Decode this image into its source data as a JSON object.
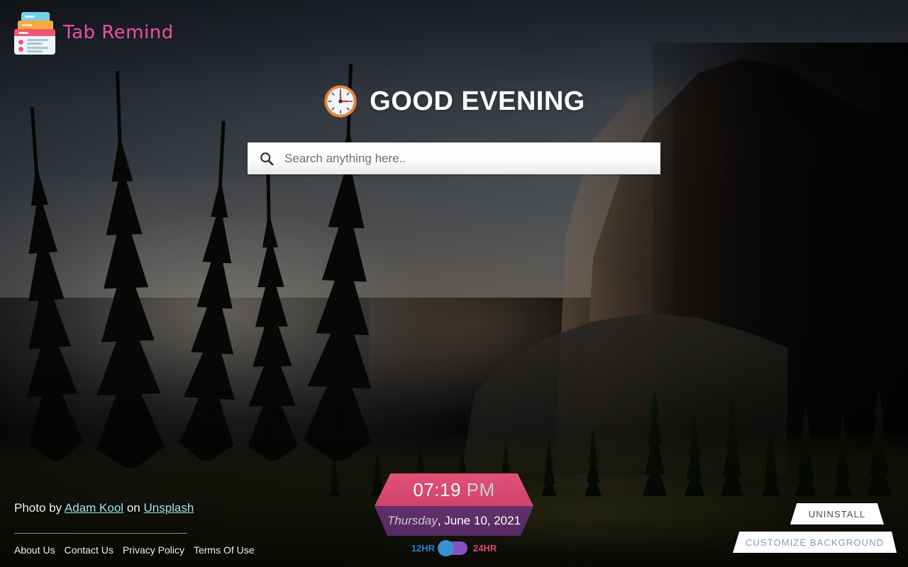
{
  "brand": {
    "name": "Tab Remind",
    "logo_icon": "stacked-tabs-icon",
    "name_color": "#ef4fa0"
  },
  "greeting": {
    "icon": "clock-icon",
    "text": "GOOD EVENING"
  },
  "search": {
    "icon": "search-icon",
    "value": "",
    "placeholder": "Search anything here.."
  },
  "clock_widget": {
    "time": "07:19",
    "meridiem": "PM",
    "day_of_week": "Thursday",
    "date_rest": ", June 10, 2021",
    "time_band_color": "#d9456f",
    "date_band_color": "#6b3a7a",
    "toggle": {
      "left_label": "12HR",
      "right_label": "24HR",
      "left_label_color": "#2f80d6",
      "right_label_color": "#e8467e",
      "track_color": "#8b4fc4",
      "knob_color": "#3b8fd4",
      "state": "12HR"
    }
  },
  "credit": {
    "prefix": "Photo by",
    "author": "Adam Kool",
    "middle": "on",
    "source": "Unsplash",
    "link_color": "#9fe8ee"
  },
  "footer": {
    "links": [
      {
        "label": "About Us"
      },
      {
        "label": "Contact Us"
      },
      {
        "label": "Privacy Policy"
      },
      {
        "label": "Terms Of Use"
      }
    ]
  },
  "actions": {
    "uninstall_label": "UNINSTALL",
    "customize_label": "CUSTOMIZE BACKGROUND"
  }
}
